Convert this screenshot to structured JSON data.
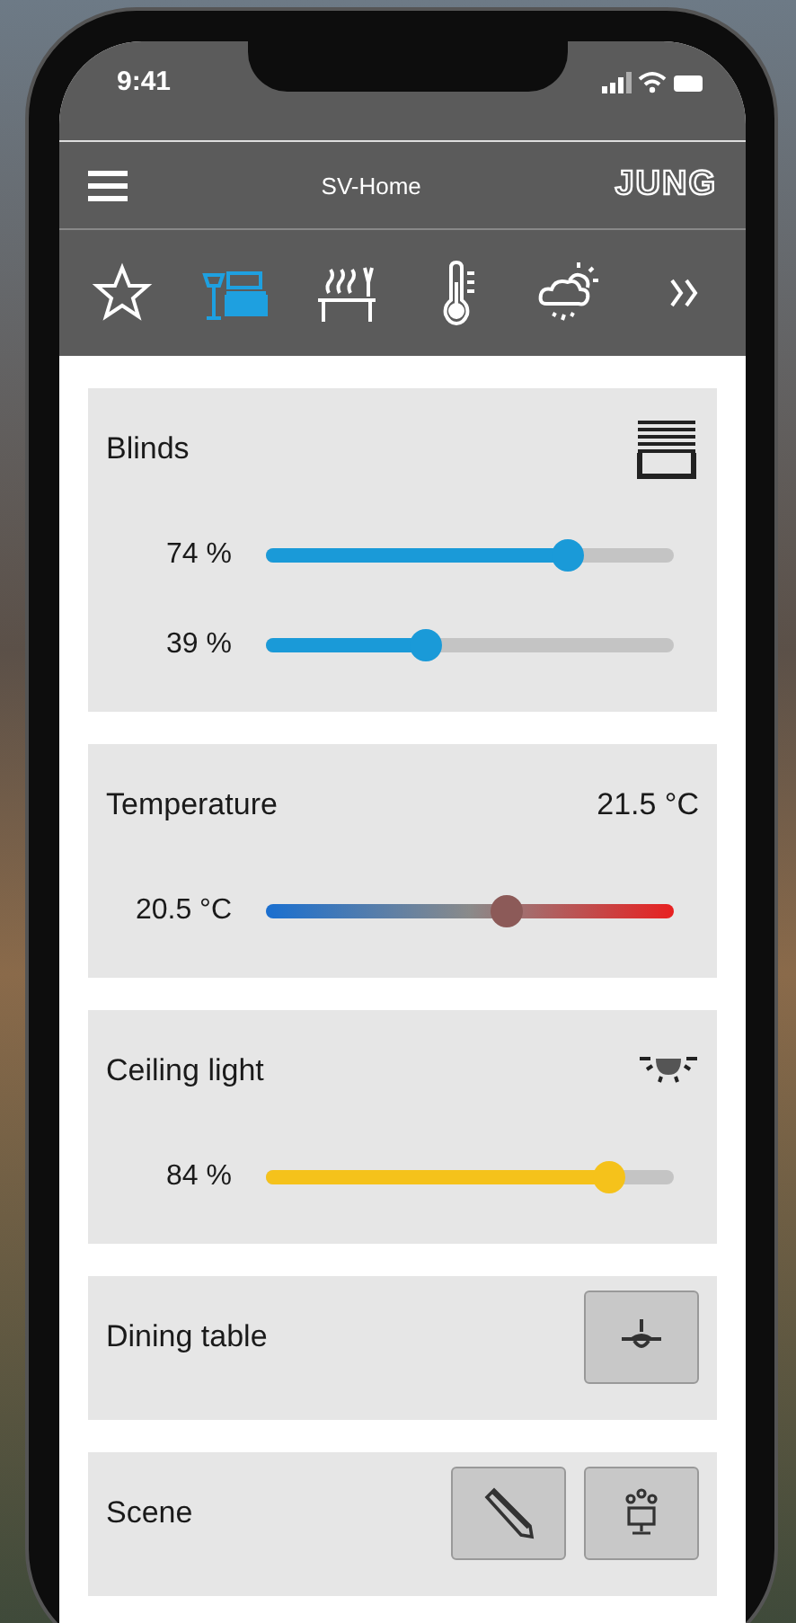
{
  "status_bar": {
    "time": "9:41"
  },
  "header": {
    "title": "SV-Home",
    "logo": "JUNG"
  },
  "category_tabs": [
    {
      "kind": "favorites",
      "selected": false
    },
    {
      "kind": "living",
      "selected": true
    },
    {
      "kind": "dining",
      "selected": false
    },
    {
      "kind": "climate",
      "selected": false
    },
    {
      "kind": "weather",
      "selected": false
    },
    {
      "kind": "more",
      "selected": false
    }
  ],
  "cards": [
    {
      "kind": "blinds",
      "title": "Blinds",
      "sliders": [
        {
          "reading": "74 %",
          "level": 0.74
        },
        {
          "reading": "39 %",
          "level": 0.39
        }
      ]
    },
    {
      "kind": "temperature",
      "title": "Temperature",
      "value": "21.5 °C",
      "sliders": [
        {
          "reading": "20.5 °C",
          "level": 0.59
        }
      ]
    },
    {
      "kind": "light",
      "title": "Ceiling light",
      "sliders": [
        {
          "reading": "84 %",
          "level": 0.84
        }
      ]
    },
    {
      "kind": "switch",
      "title": "Dining table"
    },
    {
      "kind": "scene",
      "title": "Scene"
    }
  ]
}
